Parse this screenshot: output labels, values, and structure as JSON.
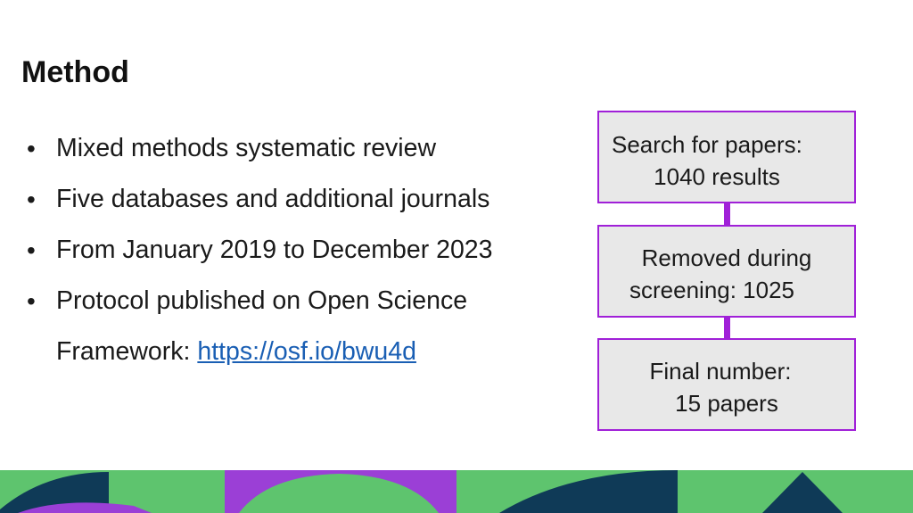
{
  "slide": {
    "title": "Method"
  },
  "bullets": [
    {
      "text": "Mixed methods systematic review"
    },
    {
      "text": "Five databases and additional journals"
    },
    {
      "text": "From January 2019 to December 2023"
    },
    {
      "text": "Protocol published on Open Science Framework: ",
      "link": "https://osf.io/bwu4d"
    }
  ],
  "flow": {
    "box1": {
      "line1": "Search for papers:",
      "line2": "1040 results"
    },
    "box2": {
      "line1": "Removed during",
      "line2": "screening: 1025"
    },
    "box3": {
      "line1": "Final number:",
      "line2": "15 papers"
    }
  },
  "colors": {
    "accent_purple": "#a020d8",
    "box_fill": "#e8e8e8",
    "link_blue": "#1a5fb4",
    "deco_green": "#5ec46e",
    "deco_purple": "#9b3fd6",
    "deco_navy": "#0f3a57"
  }
}
